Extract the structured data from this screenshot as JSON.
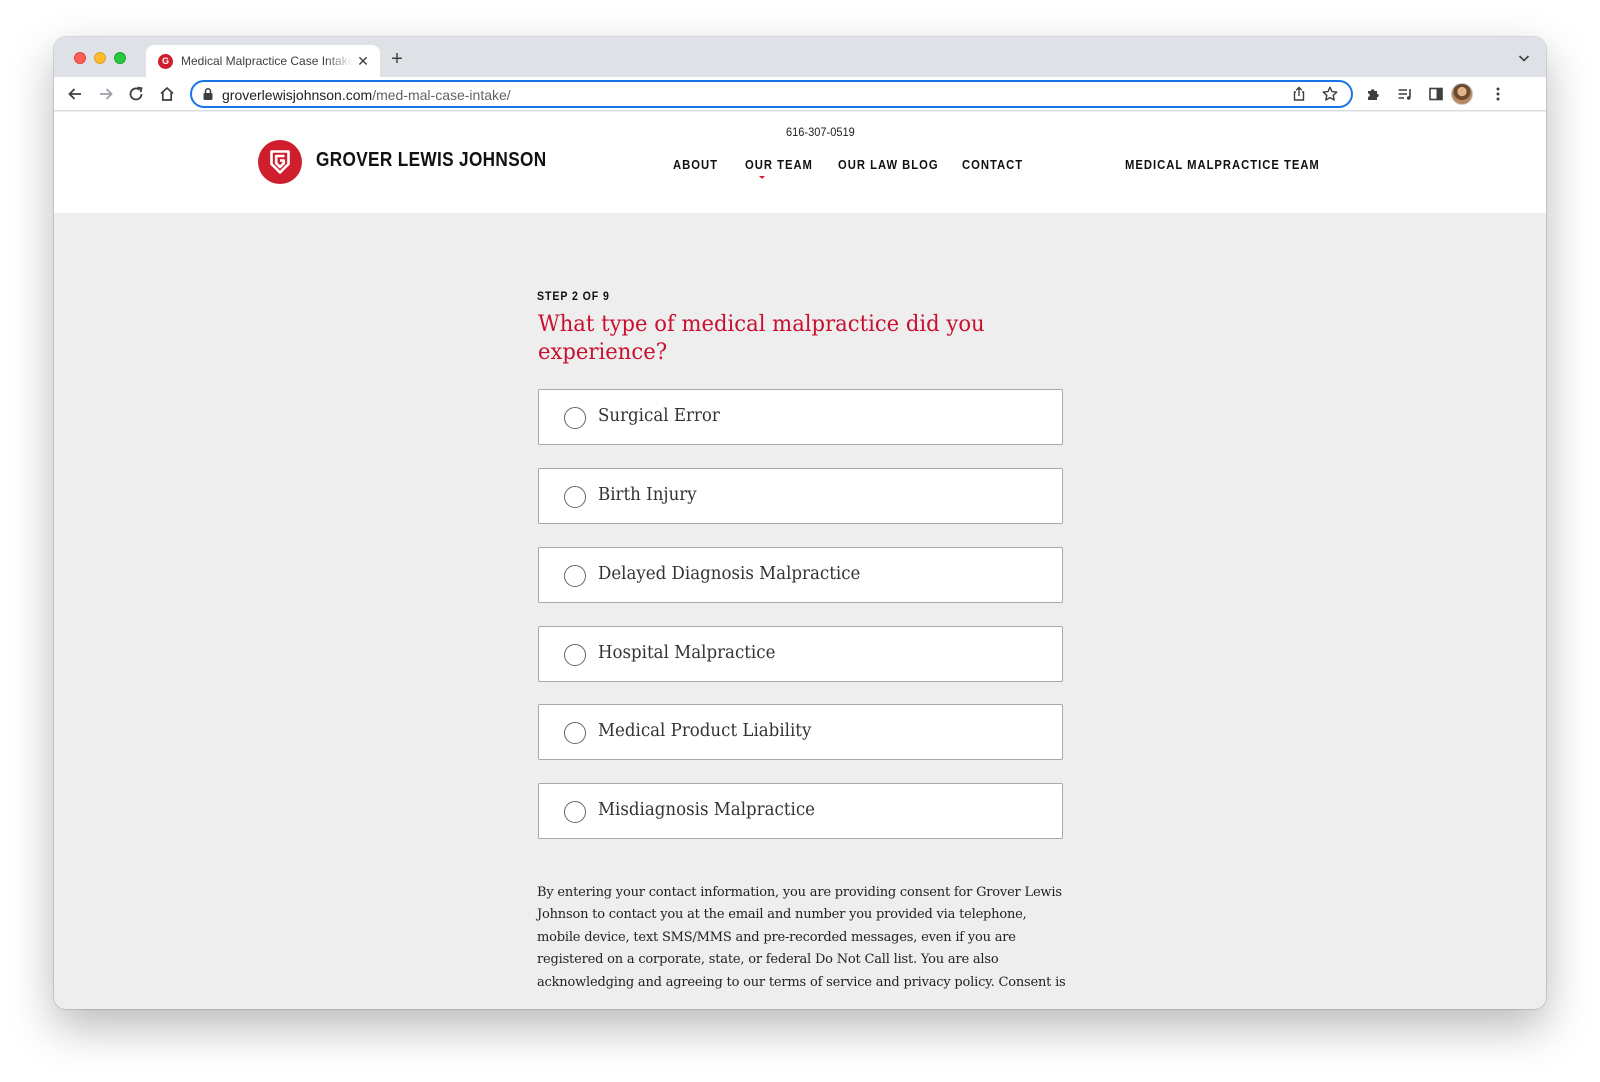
{
  "browser": {
    "tab_title": "Medical Malpractice Case Intake - Grover Lewis Johnson",
    "url_host": "groverlewisjohnson.com",
    "url_path": "/med-mal-case-intake/"
  },
  "site": {
    "brand": "GROVER LEWIS JOHNSON",
    "logo_letter": "G",
    "phone": "616-307-0519",
    "nav": [
      "ABOUT",
      "OUR TEAM",
      "OUR LAW BLOG",
      "CONTACT"
    ],
    "nav_right": "MEDICAL MALPRACTICE TEAM",
    "accent_color": "#cf1f2e"
  },
  "form": {
    "step": "STEP 2 OF 9",
    "question": "What type of medical malpractice did you experience?",
    "options": [
      "Surgical Error",
      "Birth Injury",
      "Delayed Diagnosis Malpractice",
      "Hospital Malpractice",
      "Medical Product Liability",
      "Misdiagnosis Malpractice"
    ],
    "consent": "By entering your contact information, you are providing consent for Grover Lewis Johnson to contact you at the email and number you provided via telephone, mobile device, text SMS/MMS and pre-recorded messages, even if you are registered on a corporate, state, or federal Do Not Call list. You are also acknowledging and agreeing to our terms of service and privacy policy. Consent is"
  },
  "icons": {
    "back": "arrow-left-icon",
    "forward": "arrow-right-icon",
    "reload": "reload-icon",
    "home": "home-icon",
    "lock": "lock-icon",
    "share": "share-icon",
    "bookmark": "star-icon",
    "extensions": "puzzle-icon",
    "reading_list": "reading-list-icon",
    "side_panel": "side-panel-icon",
    "menu": "kebab-menu-icon"
  }
}
